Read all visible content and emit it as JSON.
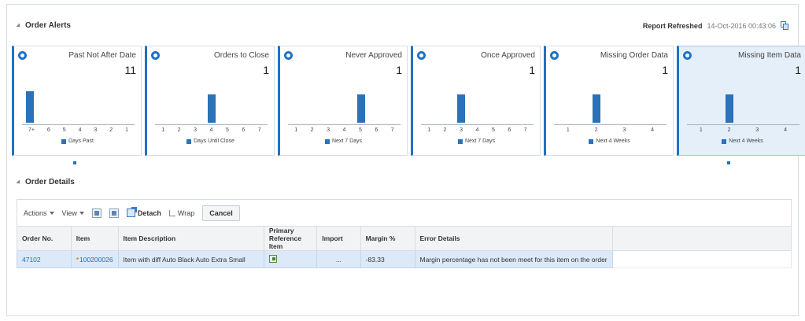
{
  "order_alerts": {
    "title": "Order Alerts",
    "report_refreshed_label": "Report Refreshed",
    "report_refreshed_time": "14-Oct-2016 00:43:06",
    "tiles": [
      {
        "title": "Past Not After Date",
        "count": "11",
        "ticks": [
          "7+",
          "6",
          "5",
          "4",
          "3",
          "2",
          "1"
        ],
        "legend": "Days Past",
        "bar_index": 0,
        "selected": false
      },
      {
        "title": "Orders to Close",
        "count": "1",
        "ticks": [
          "1",
          "2",
          "3",
          "4",
          "5",
          "6",
          "7"
        ],
        "legend": "Days Until Close",
        "bar_index": 3,
        "selected": false
      },
      {
        "title": "Never Approved",
        "count": "1",
        "ticks": [
          "1",
          "2",
          "3",
          "4",
          "5",
          "6",
          "7"
        ],
        "legend": "Next 7 Days",
        "bar_index": 4,
        "selected": false
      },
      {
        "title": "Once Approved",
        "count": "1",
        "ticks": [
          "1",
          "2",
          "3",
          "4",
          "5",
          "6",
          "7"
        ],
        "legend": "Next 7 Days",
        "bar_index": 2,
        "selected": false
      },
      {
        "title": "Missing Order Data",
        "count": "1",
        "ticks": [
          "1",
          "2",
          "3",
          "4"
        ],
        "legend": "Next 4 Weeks",
        "bar_index": 1,
        "selected": false
      },
      {
        "title": "Missing Item Data",
        "count": "1",
        "ticks": [
          "1",
          "2",
          "3",
          "4"
        ],
        "legend": "Next 4 Weeks",
        "bar_index": 1,
        "selected": true
      }
    ]
  },
  "order_details": {
    "title": "Order Details",
    "toolbar": {
      "actions_label": "Actions",
      "view_label": "View",
      "detach_label": "Detach",
      "wrap_label": "Wrap",
      "cancel_label": "Cancel"
    },
    "columns": [
      "Order No.",
      "Item",
      "Item Description",
      "Primary Reference Item",
      "Import",
      "Margin %",
      "Error Details"
    ],
    "rows": [
      {
        "order_no": "47102",
        "item": "100200026",
        "item_description": "Item with diff Auto Black Auto Extra Small",
        "import": "...",
        "margin": "-83.33",
        "error_details": "Margin percentage has not been meet for this item on the order"
      }
    ]
  },
  "colors": {
    "accent": "#1f72c6",
    "bar": "#2b72b8",
    "selected_row": "#dbe9f8"
  }
}
